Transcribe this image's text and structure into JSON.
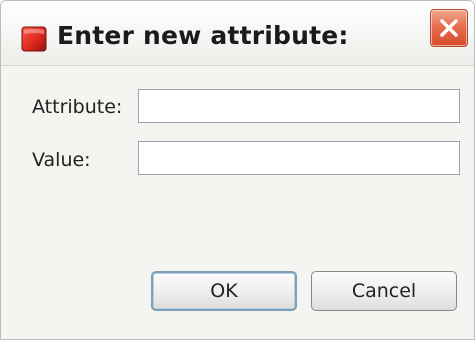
{
  "dialog": {
    "title": "Enter new attribute:",
    "icon": "red-box-icon",
    "close_icon": "close-icon"
  },
  "form": {
    "attribute_label": "Attribute:",
    "attribute_value": "",
    "value_label": "Value:",
    "value_value": ""
  },
  "buttons": {
    "ok_label": "OK",
    "cancel_label": "Cancel"
  },
  "colors": {
    "close_button": "#d64d2c",
    "app_icon": "#d8261c",
    "default_button_border": "#7f9db9"
  }
}
